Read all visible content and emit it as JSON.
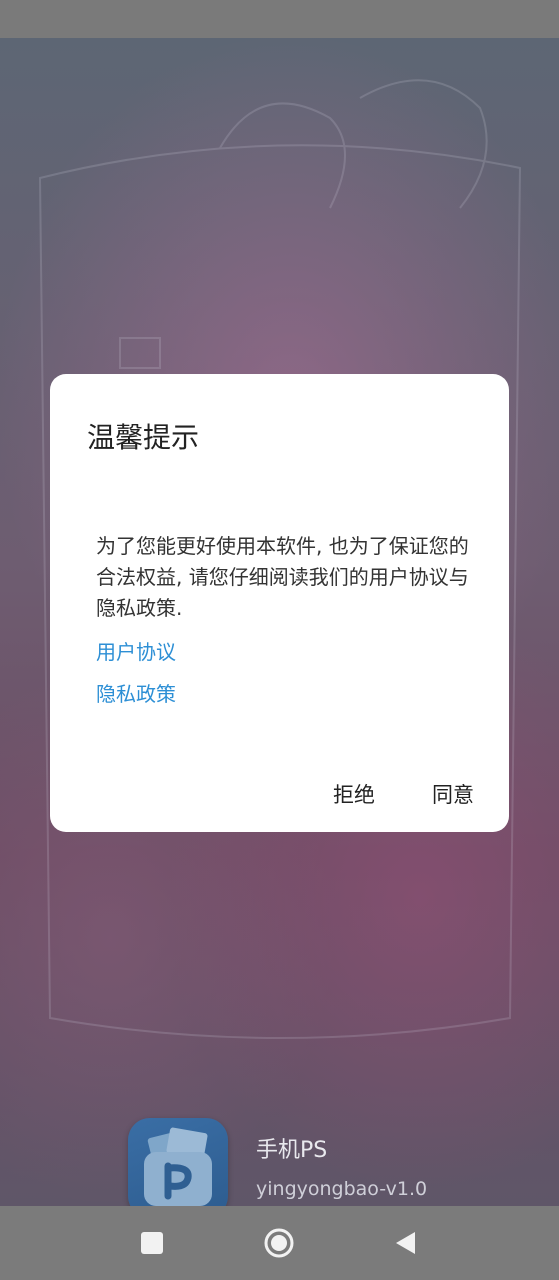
{
  "dialog": {
    "title": "温馨提示",
    "body": "为了您能更好使用本软件, 也为了保证您的合法权益, 请您仔细阅读我们的用户协议与隐私政策.",
    "link_user_agreement": "用户协议",
    "link_privacy_policy": "隐私政策",
    "reject_label": "拒绝",
    "agree_label": "同意"
  },
  "splash": {
    "app_name": "手机PS",
    "version": "yingyongbao-v1.0",
    "logo_icon": "camera-photo-icon"
  },
  "navbar": {
    "recents_icon": "square-icon",
    "home_icon": "circle-home-icon",
    "back_icon": "triangle-back-icon"
  },
  "colors": {
    "link": "#2d8fd5",
    "dialog_bg": "#ffffff",
    "navbar_bg": "#7b7b7b"
  }
}
